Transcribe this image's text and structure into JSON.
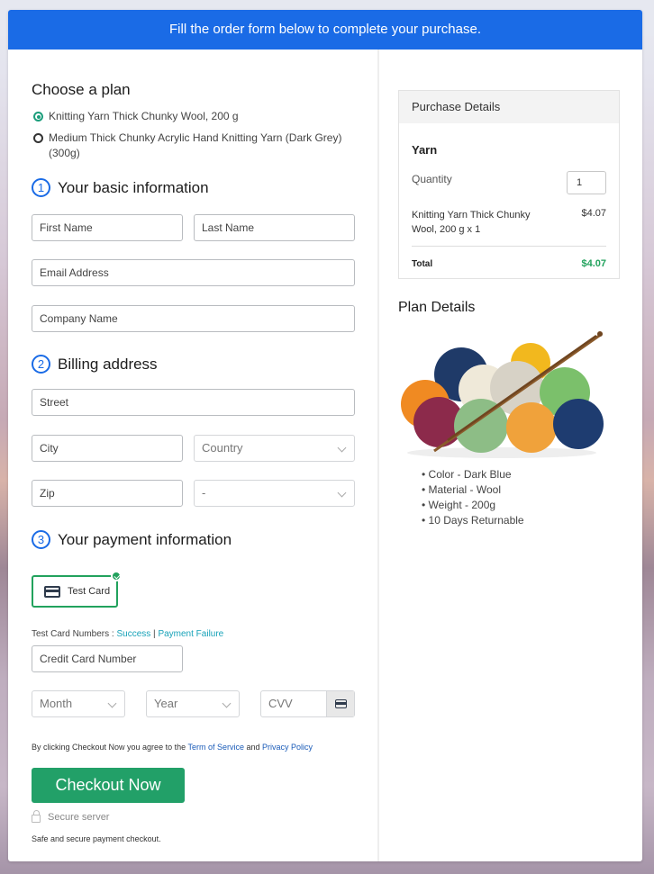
{
  "banner": {
    "text": "Fill the order form below to complete your purchase."
  },
  "plan": {
    "title": "Choose a plan",
    "options": [
      {
        "label": "Knitting Yarn Thick Chunky Wool, 200 g",
        "selected": true
      },
      {
        "label": "Medium Thick Chunky Acrylic Hand Knitting Yarn (Dark Grey) (300g)",
        "selected": false
      }
    ]
  },
  "basic": {
    "step": "1",
    "title": "Your basic information",
    "first_name_placeholder": "First Name",
    "last_name_placeholder": "Last Name",
    "email_placeholder": "Email Address",
    "company_placeholder": "Company Name"
  },
  "billing": {
    "step": "2",
    "title": "Billing address",
    "street_placeholder": "Street",
    "city_placeholder": "City",
    "country_selected": "Country",
    "zip_placeholder": "Zip",
    "state_selected": "-"
  },
  "payment": {
    "step": "3",
    "title": "Your payment information",
    "method_label": "Test Card",
    "test_numbers_label": "Test Card Numbers : ",
    "success_link": "Success",
    "separator": " | ",
    "failure_link": "Payment Failure",
    "card_number_placeholder": "Credit Card Number",
    "month_selected": "Month",
    "year_selected": "Year",
    "cvv_placeholder": "CVV"
  },
  "agreement": {
    "prefix": "By clicking Checkout Now you agree to the ",
    "terms_link": "Term of Service",
    "and": " and ",
    "privacy_link": "Privacy Policy"
  },
  "checkout_button": "Checkout Now",
  "secure_label": "Secure server",
  "safe_text": "Safe and secure payment checkout.",
  "purchase": {
    "header": "Purchase Details",
    "product_group": "Yarn",
    "quantity_label": "Quantity",
    "quantity_value": "1",
    "item_label": "Knitting Yarn Thick Chunky Wool, 200 g x 1",
    "item_price": "$4.07",
    "total_label": "Total",
    "total_value": "$4.07"
  },
  "plan_details": {
    "title": "Plan Details",
    "features": [
      "Color - Dark Blue",
      "Material - Wool",
      "Weight - 200g",
      "10 Days Returnable"
    ]
  },
  "colors": {
    "brand_blue": "#1a6be6",
    "success_green": "#22a068",
    "link_teal": "#17a2b8"
  }
}
